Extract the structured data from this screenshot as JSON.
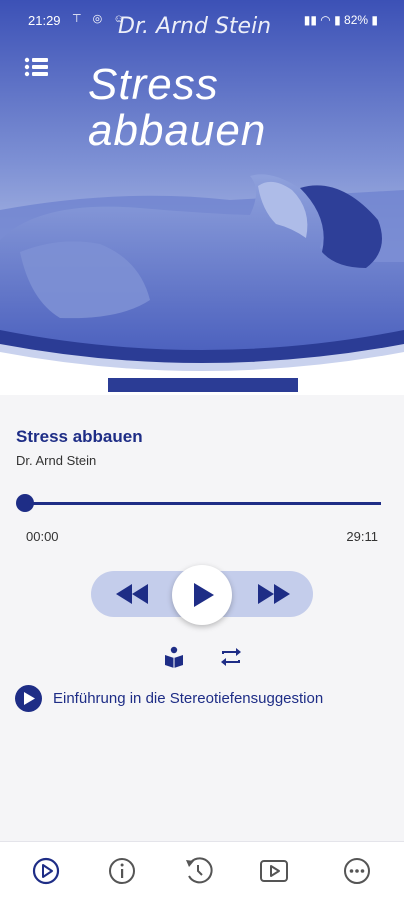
{
  "status_bar": {
    "time": "21:29",
    "battery": "82%"
  },
  "header": {
    "author_overlay": "Dr. Arnd Stein",
    "title_line1": "Stress",
    "title_line2": "abbauen",
    "menu_icon": "list-icon"
  },
  "track": {
    "title": "Stress abbauen",
    "author": "Dr. Arnd Stein"
  },
  "player": {
    "current_time": "00:00",
    "total_time": "29:11",
    "progress": 0
  },
  "controls": {
    "rewind_icon": "rewind-icon",
    "play_icon": "play-icon",
    "forward_icon": "fast-forward-icon",
    "mode_icon": "reader-icon",
    "repeat_icon": "repeat-icon"
  },
  "chapter": {
    "label": "Einführung in die Stereotiefensuggestion"
  },
  "bottom_nav": [
    "player-icon",
    "info-icon",
    "history-icon",
    "video-icon",
    "more-icon"
  ],
  "colors": {
    "primary": "#1e2d86",
    "pill": "#c4cdeb",
    "hero_blue": "#3f55b8"
  }
}
